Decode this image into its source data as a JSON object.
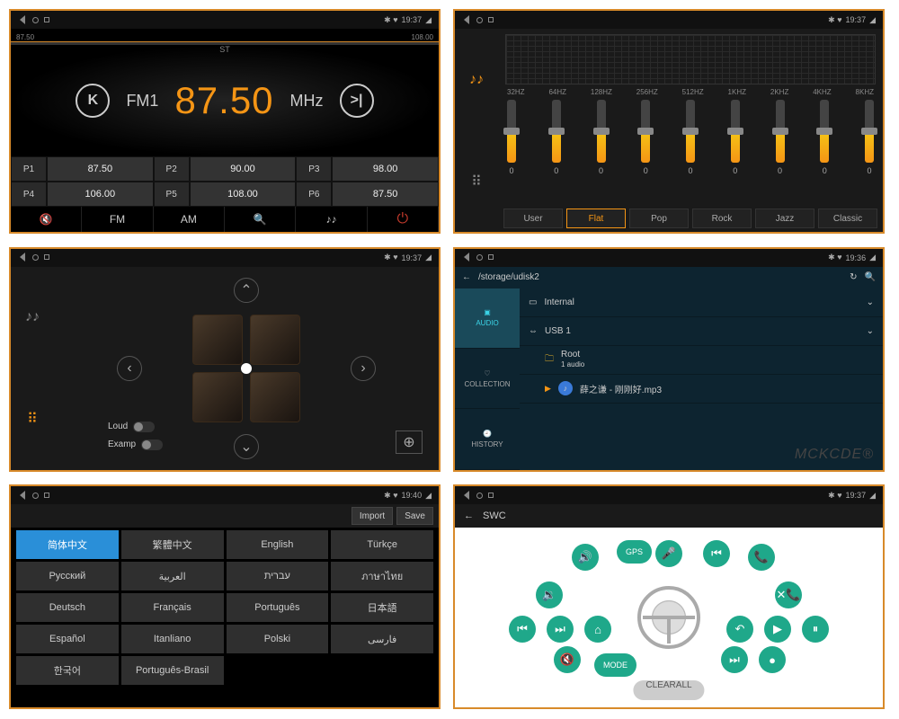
{
  "status": {
    "time1": "19:37",
    "time2": "19:37",
    "time3": "19:37",
    "time4": "19:36",
    "time5": "19:40",
    "time6": "19:37"
  },
  "radio": {
    "freq_min": "87.50",
    "freq_max": "108.00",
    "st": "ST",
    "band": "FM1",
    "freq": "87.50",
    "unit": "MHz",
    "presets": [
      {
        "n": "P1",
        "v": "87.50"
      },
      {
        "n": "P2",
        "v": "90.00"
      },
      {
        "n": "P3",
        "v": "98.00"
      },
      {
        "n": "P4",
        "v": "106.00"
      },
      {
        "n": "P5",
        "v": "108.00"
      },
      {
        "n": "P6",
        "v": "87.50"
      }
    ],
    "bottom": {
      "fm": "FM",
      "am": "AM"
    }
  },
  "eq": {
    "bands": [
      "32HZ",
      "64HZ",
      "128HZ",
      "256HZ",
      "512HZ",
      "1KHZ",
      "2KHZ",
      "4KHZ",
      "8KHZ"
    ],
    "values": [
      "0",
      "0",
      "0",
      "0",
      "0",
      "0",
      "0",
      "0",
      "0"
    ],
    "tabs": [
      "User",
      "Flat",
      "Pop",
      "Rock",
      "Jazz",
      "Classic"
    ],
    "active_tab": "Flat"
  },
  "fader": {
    "loud": "Loud",
    "examp": "Examp"
  },
  "files": {
    "path": "/storage/udisk2",
    "side": [
      "AUDIO",
      "COLLECTION",
      "HISTORY"
    ],
    "rows": {
      "internal": "Internal",
      "usb": "USB 1",
      "root": "Root",
      "sub": "1 audio",
      "track": "薛之谦 - 刚刚好.mp3"
    },
    "watermark": "MCKCDE®"
  },
  "lang": {
    "import": "Import",
    "save": "Save",
    "cells": [
      "简体中文",
      "繁體中文",
      "English",
      "Türkçe",
      "Русский",
      "العربية",
      "עברית",
      "ภาษาไทย",
      "Deutsch",
      "Français",
      "Português",
      "日本語",
      "Español",
      "Itanliano",
      "Polski",
      "فارسی",
      "한국어",
      "Português-Brasil"
    ]
  },
  "swc": {
    "title": "SWC",
    "buttons": {
      "gps": "GPS",
      "mode": "MODE",
      "clear": "CLEARALL"
    }
  }
}
